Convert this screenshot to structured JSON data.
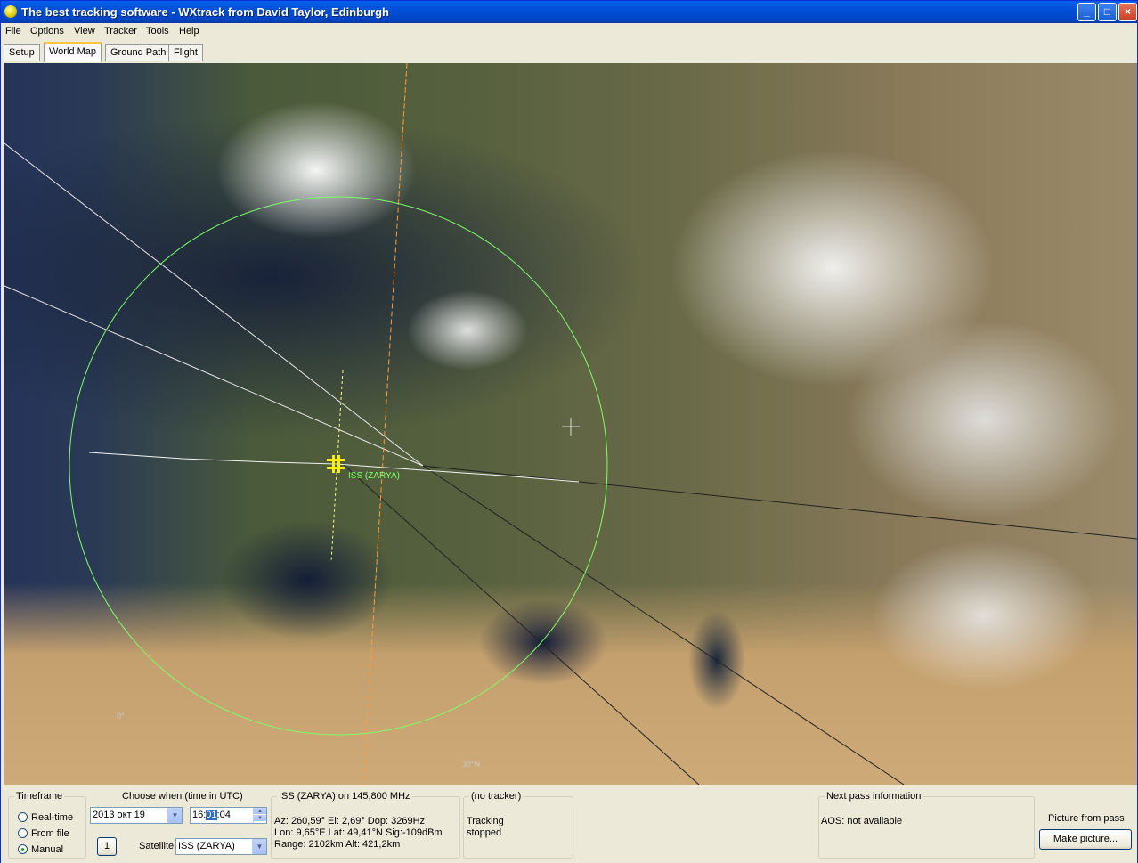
{
  "window": {
    "title": "The best tracking software - WXtrack from David Taylor, Edinburgh",
    "buttons": {
      "minimize": "_",
      "maximize": "□",
      "close": "×"
    }
  },
  "menu": [
    "File",
    "Options",
    "View",
    "Tracker",
    "Tools",
    "Help"
  ],
  "tabs": [
    "Setup",
    "World Map",
    "Ground Path",
    "Flight"
  ],
  "active_tab": "World Map",
  "map": {
    "satellite_label": "ISS (ZARYA)",
    "lat_labels": [
      "0°",
      "30°N"
    ]
  },
  "timeframe": {
    "legend": "Timeframe",
    "options": [
      "Real-time",
      "From file",
      "Manual"
    ],
    "selected": "Manual"
  },
  "choose_when": {
    "label": "Choose when (time in UTC)",
    "date": "2013 окт  19",
    "time_prefix": "16:",
    "time_selected": "01",
    "time_suffix": ":04",
    "step_button": "1",
    "satellite_label": "Satellite",
    "satellite_value": "ISS (ZARYA)"
  },
  "sat_info": {
    "legend": "ISS (ZARYA) on 145,800 MHz",
    "lines": [
      "Az: 260,59°  El: 2,69°  Dop: 3269Hz",
      "Lon: 9,65°E  Lat: 49,41°N  Sig:-109dBm",
      "Range: 2102km  Alt: 421,2km"
    ]
  },
  "tracker": {
    "legend": "(no tracker)",
    "lines": [
      "Tracking",
      "stopped"
    ]
  },
  "next_pass": {
    "legend": "Next pass information",
    "text": "AOS: not available"
  },
  "picture": {
    "label": "Picture from pass",
    "button": "Make picture..."
  },
  "colors": {
    "titlebar": "#0050d8",
    "coverage_circle": "#7dff66",
    "ground_track": "#ff9a3c",
    "satellite_marker": "#ffee00"
  }
}
